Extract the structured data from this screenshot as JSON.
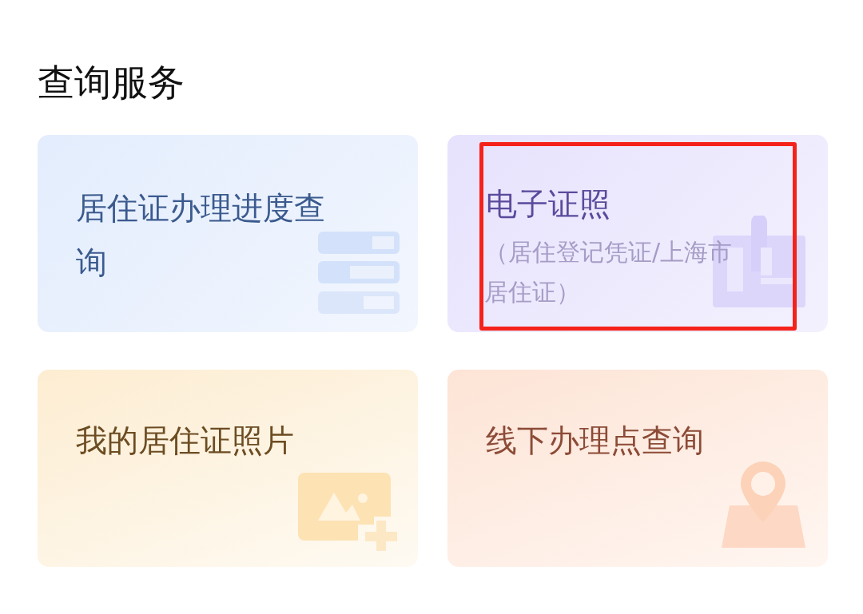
{
  "section_title": "查询服务",
  "cards": [
    {
      "kind": "progress",
      "title": "居住证办理进度查询",
      "highlighted": false
    },
    {
      "kind": "license",
      "title": "电子证照",
      "subtitle": "（居住登记凭证/上海市居住证）",
      "highlighted": true
    },
    {
      "kind": "photo",
      "title": "我的居住证照片",
      "highlighted": false
    },
    {
      "kind": "location",
      "title": "线下办理点查询",
      "highlighted": false
    }
  ]
}
